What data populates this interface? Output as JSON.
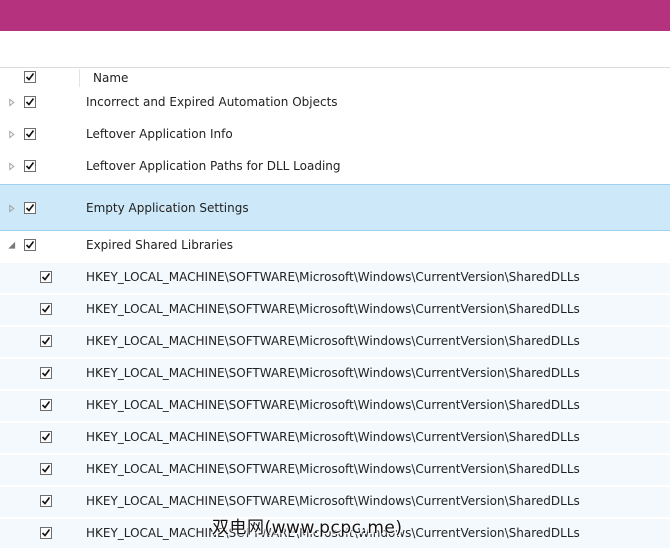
{
  "header": {
    "name_column": "Name"
  },
  "categories": [
    {
      "label": "Incorrect and Expired Automation Objects",
      "checked": true,
      "expanded": false,
      "selected": false
    },
    {
      "label": "Leftover Application Info",
      "checked": true,
      "expanded": false,
      "selected": false
    },
    {
      "label": "Leftover Application Paths for DLL Loading",
      "checked": true,
      "expanded": false,
      "selected": false
    },
    {
      "label": "Empty Application Settings",
      "checked": true,
      "expanded": false,
      "selected": true
    },
    {
      "label": "Expired Shared Libraries",
      "checked": true,
      "expanded": true,
      "selected": false
    }
  ],
  "children": [
    {
      "label": "HKEY_LOCAL_MACHINE\\SOFTWARE\\Microsoft\\Windows\\CurrentVersion\\SharedDLLs",
      "checked": true
    },
    {
      "label": "HKEY_LOCAL_MACHINE\\SOFTWARE\\Microsoft\\Windows\\CurrentVersion\\SharedDLLs",
      "checked": true
    },
    {
      "label": "HKEY_LOCAL_MACHINE\\SOFTWARE\\Microsoft\\Windows\\CurrentVersion\\SharedDLLs",
      "checked": true
    },
    {
      "label": "HKEY_LOCAL_MACHINE\\SOFTWARE\\Microsoft\\Windows\\CurrentVersion\\SharedDLLs",
      "checked": true
    },
    {
      "label": "HKEY_LOCAL_MACHINE\\SOFTWARE\\Microsoft\\Windows\\CurrentVersion\\SharedDLLs",
      "checked": true
    },
    {
      "label": "HKEY_LOCAL_MACHINE\\SOFTWARE\\Microsoft\\Windows\\CurrentVersion\\SharedDLLs",
      "checked": true
    },
    {
      "label": "HKEY_LOCAL_MACHINE\\SOFTWARE\\Microsoft\\Windows\\CurrentVersion\\SharedDLLs",
      "checked": true
    },
    {
      "label": "HKEY_LOCAL_MACHINE\\SOFTWARE\\Microsoft\\Windows\\CurrentVersion\\SharedDLLs",
      "checked": true
    },
    {
      "label": "HKEY_LOCAL_MACHINE\\SOFTWARE\\Microsoft\\Windows\\CurrentVersion\\SharedDLLs",
      "checked": true
    }
  ],
  "watermark": "双电网(www.pcpc.me)",
  "colors": {
    "titlebar": "#b5327e",
    "selected_row": "#cde8f8",
    "selected_border": "#9fd0ef"
  },
  "icons": {
    "checkbox": "check-icon",
    "collapsed": "triangle-right-icon",
    "expanded": "triangle-down-icon"
  }
}
